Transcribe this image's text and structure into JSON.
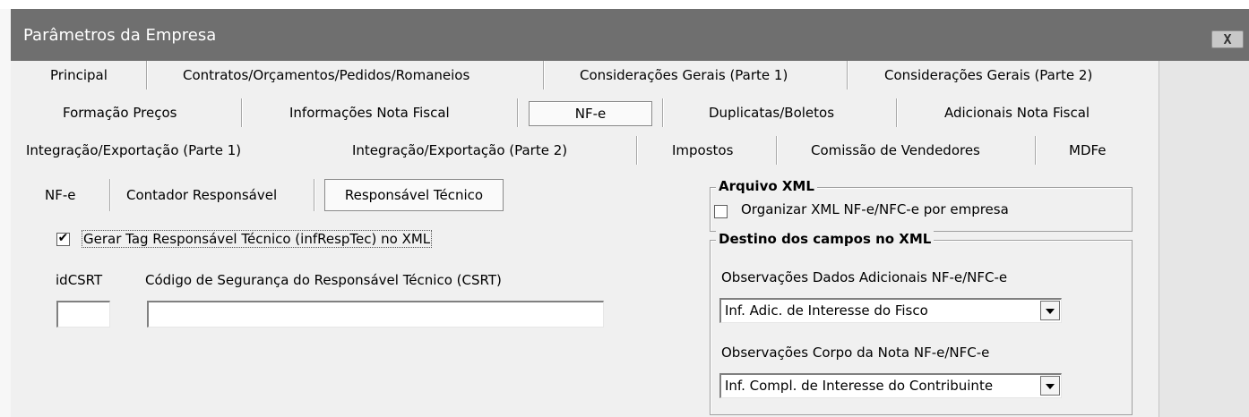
{
  "window": {
    "title": "Parâmetros da Empresa",
    "close_label": "X"
  },
  "tabs_row1": [
    "Principal",
    "Contratos/Orçamentos/Pedidos/Romaneios",
    "Considerações Gerais (Parte 1)",
    "Considerações Gerais (Parte 2)"
  ],
  "tabs_row2": [
    "Formação Preços",
    "Informações Nota Fiscal",
    "NF-e",
    "Duplicatas/Boletos",
    "Adicionais Nota Fiscal"
  ],
  "tabs_row3": [
    "Integração/Exportação (Parte 1)",
    "Integração/Exportação (Parte 2)",
    "Impostos",
    "Comissão de Vendedores",
    "MDFe"
  ],
  "active_tab": "NF-e",
  "subtabs": [
    "NF-e",
    "Contador Responsável",
    "Responsável Técnico"
  ],
  "active_subtab": "Responsável Técnico",
  "responsavel": {
    "gerar_tag_label": "Gerar Tag Responsável Técnico (infRespTec) no XML",
    "gerar_tag_checked": true,
    "idcsrt_label": "idCSRT",
    "idcsrt_value": "",
    "csrt_label": "Código de Segurança do Responsável Técnico (CSRT)",
    "csrt_value": ""
  },
  "arquivo_xml": {
    "title": "Arquivo XML",
    "organizar_label": "Organizar XML NF-e/NFC-e por empresa",
    "organizar_checked": false
  },
  "destino": {
    "title": "Destino dos campos no XML",
    "obs_adic_label": "Observações Dados Adicionais NF-e/NFC-e",
    "obs_adic_value": "Inf. Adic. de Interesse do Fisco",
    "obs_corpo_label": "Observações Corpo da Nota NF-e/NFC-e",
    "obs_corpo_value": "Inf. Compl. de Interesse do Contribuinte"
  },
  "check_glyph": "✔"
}
